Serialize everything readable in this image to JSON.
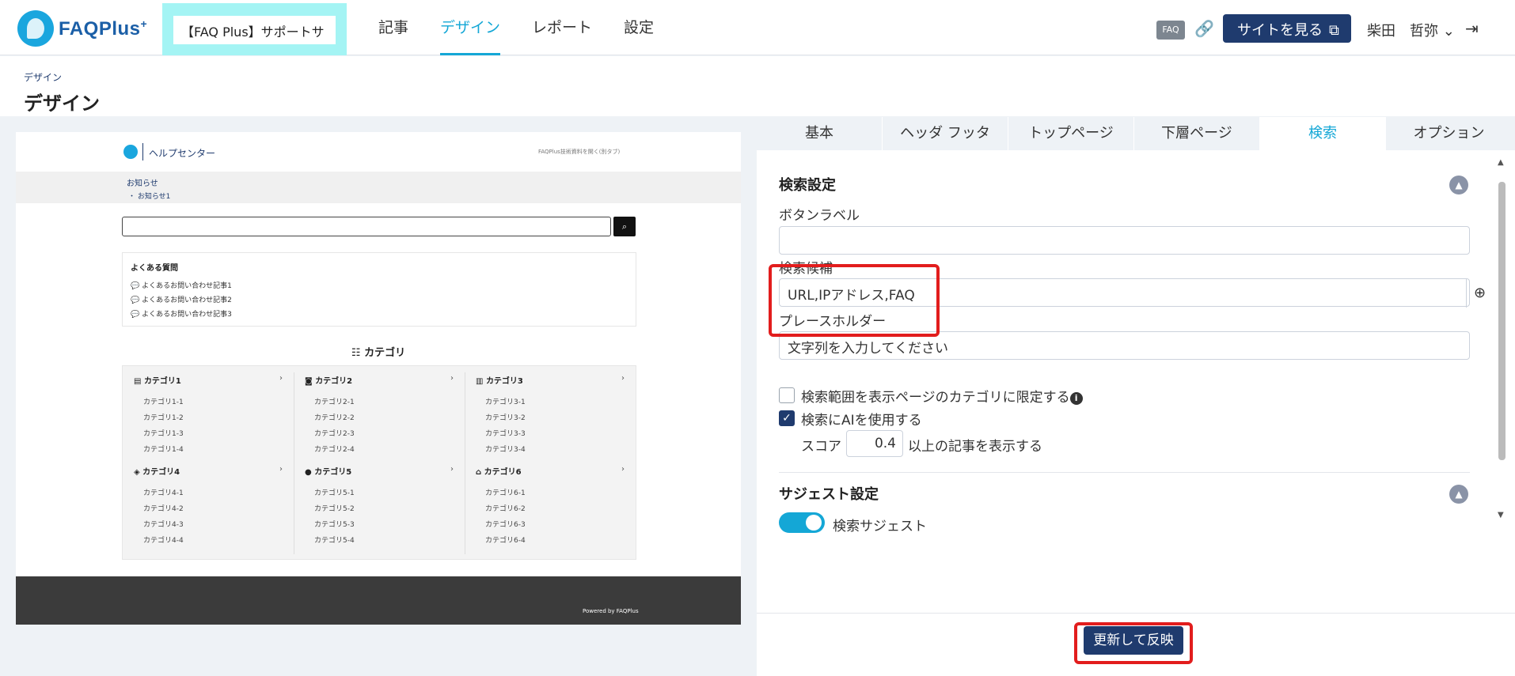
{
  "brand": {
    "name": "FAQPlus",
    "plus": "+"
  },
  "site_select": "【FAQ Plus】サポートサ",
  "nav": [
    {
      "label": "記事",
      "active": false
    },
    {
      "label": "デザイン",
      "active": true
    },
    {
      "label": "レポート",
      "active": false
    },
    {
      "label": "設定",
      "active": false
    }
  ],
  "header_right": {
    "faq_badge": "FAQ",
    "view_site": "サイトを見る",
    "user": "柴田　哲弥"
  },
  "page": {
    "breadcrumb": "デザイン",
    "title": "デザイン"
  },
  "preview": {
    "help_center": "ヘルプセンター",
    "header_link": "FAQPlus技術資料を開く(別タブ)",
    "notice_title": "お知らせ",
    "notice_item": "・ お知らせ1",
    "faq_title": "よくある質問",
    "faq_items": [
      "よくあるお問い合わせ記事1",
      "よくあるお問い合わせ記事2",
      "よくあるお問い合わせ記事3"
    ],
    "category_title": "カテゴリ",
    "categories": [
      {
        "name": "カテゴリ1",
        "subs": [
          "カテゴリ1-1",
          "カテゴリ1-2",
          "カテゴリ1-3",
          "カテゴリ1-4"
        ]
      },
      {
        "name": "カテゴリ2",
        "subs": [
          "カテゴリ2-1",
          "カテゴリ2-2",
          "カテゴリ2-3",
          "カテゴリ2-4"
        ]
      },
      {
        "name": "カテゴリ3",
        "subs": [
          "カテゴリ3-1",
          "カテゴリ3-2",
          "カテゴリ3-3",
          "カテゴリ3-4"
        ]
      },
      {
        "name": "カテゴリ4",
        "subs": [
          "カテゴリ4-1",
          "カテゴリ4-2",
          "カテゴリ4-3",
          "カテゴリ4-4"
        ]
      },
      {
        "name": "カテゴリ5",
        "subs": [
          "カテゴリ5-1",
          "カテゴリ5-2",
          "カテゴリ5-3",
          "カテゴリ5-4"
        ]
      },
      {
        "name": "カテゴリ6",
        "subs": [
          "カテゴリ6-1",
          "カテゴリ6-2",
          "カテゴリ6-3",
          "カテゴリ6-4"
        ]
      }
    ],
    "footer": "Powered by FAQPlus"
  },
  "tabs": [
    {
      "label": "基本",
      "active": false
    },
    {
      "label": "ヘッダ フッタ",
      "active": false
    },
    {
      "label": "トップページ",
      "active": false
    },
    {
      "label": "下層ページ",
      "active": false
    },
    {
      "label": "検索",
      "active": true
    },
    {
      "label": "オプション",
      "active": false
    }
  ],
  "search_settings": {
    "title": "検索設定",
    "button_label_label": "ボタンラベル",
    "button_label_value": "",
    "suggestions_label": "検索候補",
    "suggestions_value": "URL,IPアドレス,FAQ",
    "placeholder_label": "プレースホルダー",
    "placeholder_value": "文字列を入力してください",
    "limit_scope_label": "検索範囲を表示ページのカテゴリに限定する",
    "limit_scope_checked": false,
    "use_ai_label": "検索にAIを使用する",
    "use_ai_checked": true,
    "score_label": "スコア",
    "score_value": "0.4",
    "score_suffix": "以上の記事を表示する"
  },
  "suggest_settings": {
    "title": "サジェスト設定",
    "toggle_label": "検索サジェスト",
    "toggle_on": true
  },
  "update_button": "更新して反映",
  "colors": {
    "primary": "#1f3b6e",
    "accent": "#14a7d6",
    "highlight": "#e21d1d",
    "site_select_bg": "#a4f4f4"
  }
}
